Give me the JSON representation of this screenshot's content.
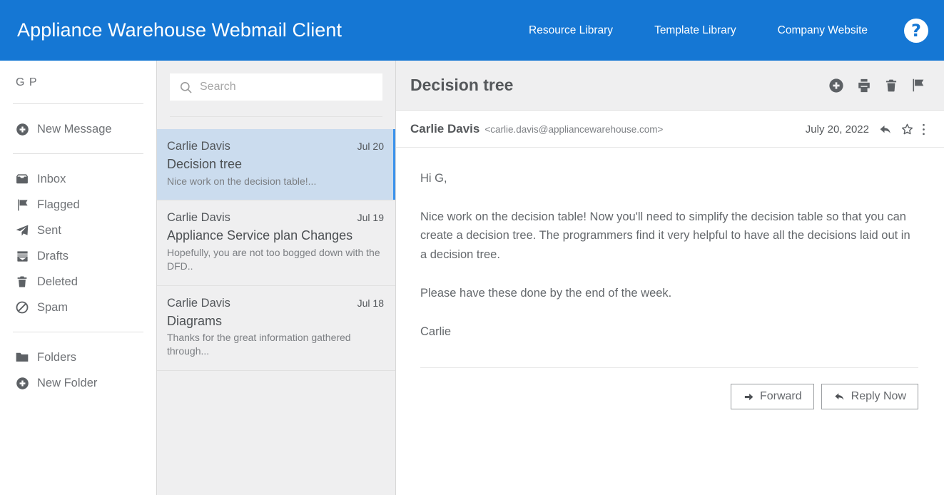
{
  "header": {
    "title": "Appliance Warehouse Webmail Client",
    "nav": [
      {
        "label": "Resource Library"
      },
      {
        "label": "Template Library"
      },
      {
        "label": "Company Website"
      }
    ],
    "help_icon": "help-question-icon",
    "help_label": "?",
    "background_color": "#1577d4"
  },
  "sidebar": {
    "user_initials": "G P",
    "compose": {
      "label": "New Message",
      "icon": "plus-circle-icon"
    },
    "folders": [
      {
        "label": "Inbox",
        "icon": "inbox-icon"
      },
      {
        "label": "Flagged",
        "icon": "flag-icon"
      },
      {
        "label": "Sent",
        "icon": "paper-plane-icon"
      },
      {
        "label": "Drafts",
        "icon": "drafts-envelope-icon"
      },
      {
        "label": "Deleted",
        "icon": "trash-icon"
      },
      {
        "label": "Spam",
        "icon": "ban-icon"
      }
    ],
    "folder_actions": [
      {
        "label": "Folders",
        "icon": "folder-icon"
      },
      {
        "label": "New Folder",
        "icon": "plus-circle-icon"
      }
    ]
  },
  "message_list": {
    "search": {
      "placeholder": "Search",
      "value": "",
      "icon": "search-icon"
    },
    "items": [
      {
        "sender": "Carlie Davis",
        "date": "Jul 20",
        "subject": "Decision tree",
        "preview": "Nice work on the decision table!...",
        "selected": true
      },
      {
        "sender": "Carlie Davis",
        "date": "Jul 19",
        "subject": "Appliance Service plan Changes",
        "preview": "Hopefully, you are not too bogged down with the DFD..",
        "selected": false
      },
      {
        "sender": "Carlie Davis",
        "date": "Jul 18",
        "subject": "Diagrams",
        "preview": "Thanks for the great information gathered through...",
        "selected": false
      }
    ],
    "selected_background_color": "#cbdcee",
    "accent_color": "#3b92ec"
  },
  "reading_pane": {
    "title": "Decision tree",
    "toolbar": [
      {
        "name": "add-icon",
        "label": "Add"
      },
      {
        "name": "print-icon",
        "label": "Print"
      },
      {
        "name": "delete-icon",
        "label": "Delete"
      },
      {
        "name": "flag-icon",
        "label": "Flag"
      }
    ],
    "sender_name": "Carlie Davis",
    "sender_email": "<carlie.davis@appliancewarehouse.com>",
    "date": "July 20, 2022",
    "message_actions": [
      {
        "name": "reply-arrow-icon",
        "label": "Reply"
      },
      {
        "name": "star-outline-icon",
        "label": "Star"
      },
      {
        "name": "more-vertical-icon",
        "label": "More"
      }
    ],
    "body": [
      "Hi G,",
      "Nice work on the decision table! Now you'll need to simplify the decision table so that you can create a decision tree. The programmers find it very helpful to have all the decisions laid out in a decision tree.",
      "Please have these done by the end of the week.",
      "Carlie"
    ],
    "buttons": {
      "forward": {
        "label": "Forward",
        "icon": "arrow-right-icon"
      },
      "reply_now": {
        "label": "Reply Now",
        "icon": "reply-arrow-icon"
      }
    }
  }
}
